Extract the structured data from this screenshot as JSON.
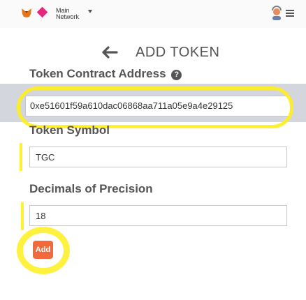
{
  "header": {
    "network_line1": "Main",
    "network_line2": "Network",
    "icons": [
      "metamask-fox-icon",
      "network-diamond-icon",
      "chevron-down-icon",
      "account-icon",
      "menu-icon"
    ]
  },
  "page": {
    "title": "ADD TOKEN"
  },
  "fields": {
    "address_label": "Token Contract Address",
    "address_help": "?",
    "address_value": "0xe51601f59a610dac06868aa711a05e9a4e29125",
    "symbol_label": "Token Symbol",
    "symbol_value": "TGC",
    "decimals_label": "Decimals of Precision",
    "decimals_value": "18"
  },
  "actions": {
    "add_label": "Add"
  },
  "colors": {
    "accent": "#f26a3b",
    "highlight": "#ffee1e",
    "network": "#e2287a"
  }
}
